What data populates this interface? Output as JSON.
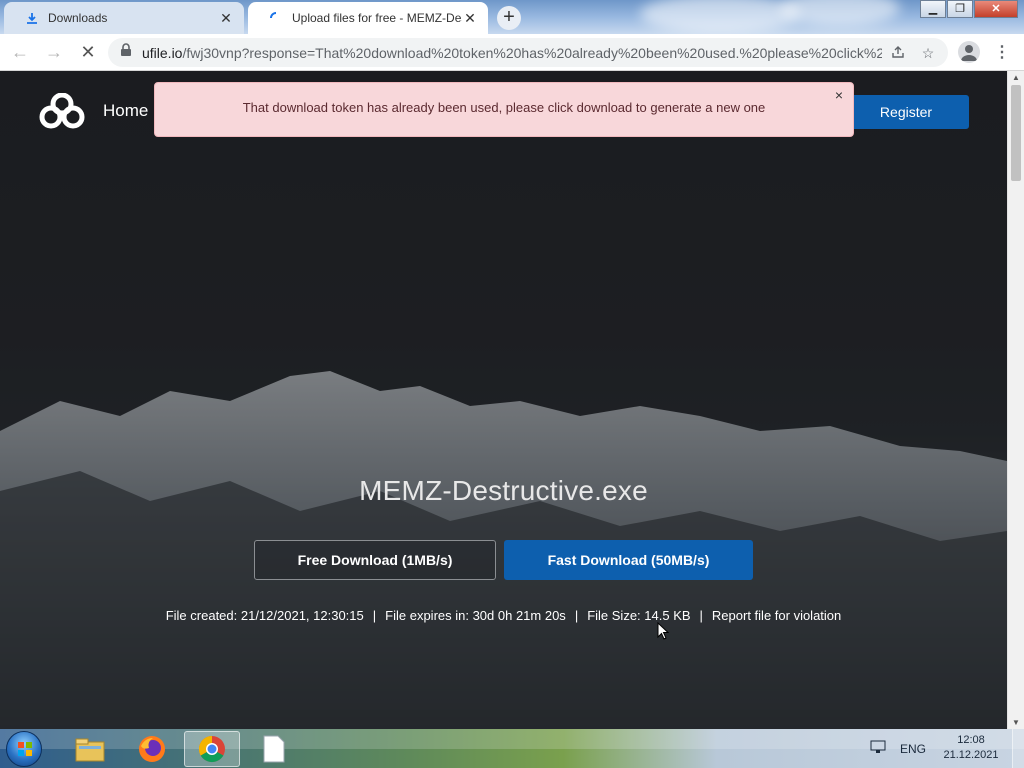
{
  "browser": {
    "tabs": [
      {
        "title": "Downloads",
        "icon": "download-icon",
        "active": false
      },
      {
        "title": "Upload files for free - MEMZ-Des",
        "icon": "loading-spinner-icon",
        "active": true
      }
    ],
    "new_tab_label": "+",
    "address_bar": {
      "host": "ufile.io",
      "path": "/fwj30vnp?response=That%20download%20token%20has%20already%20been%20used.%20please%20click%2..."
    },
    "window_controls": [
      "minimize",
      "restore",
      "close"
    ]
  },
  "page": {
    "nav": {
      "home_label": "Home",
      "register_label": "Register"
    },
    "alert": {
      "message": "That download token has already been used, please click download to generate a new one",
      "close_label": "×"
    },
    "file": {
      "name": "MEMZ-Destructive.exe",
      "free_download_label": "Free Download (1MB/s)",
      "fast_download_label": "Fast Download (50MB/s)",
      "created": "File created: 21/12/2021, 12:30:15",
      "expires": "File expires in: 30d 0h 21m 20s",
      "size": "File Size: 14.5 KB",
      "report_label": "Report file for violation",
      "separator": "|"
    },
    "colors": {
      "accent": "#0d5fae",
      "alert_bg": "#f8d7da"
    }
  },
  "taskbar": {
    "apps": [
      "windows-explorer-icon",
      "firefox-icon",
      "chrome-icon",
      "blank-document-icon"
    ],
    "language": "ENG",
    "time": "12:08",
    "date": "21.12.2021"
  }
}
